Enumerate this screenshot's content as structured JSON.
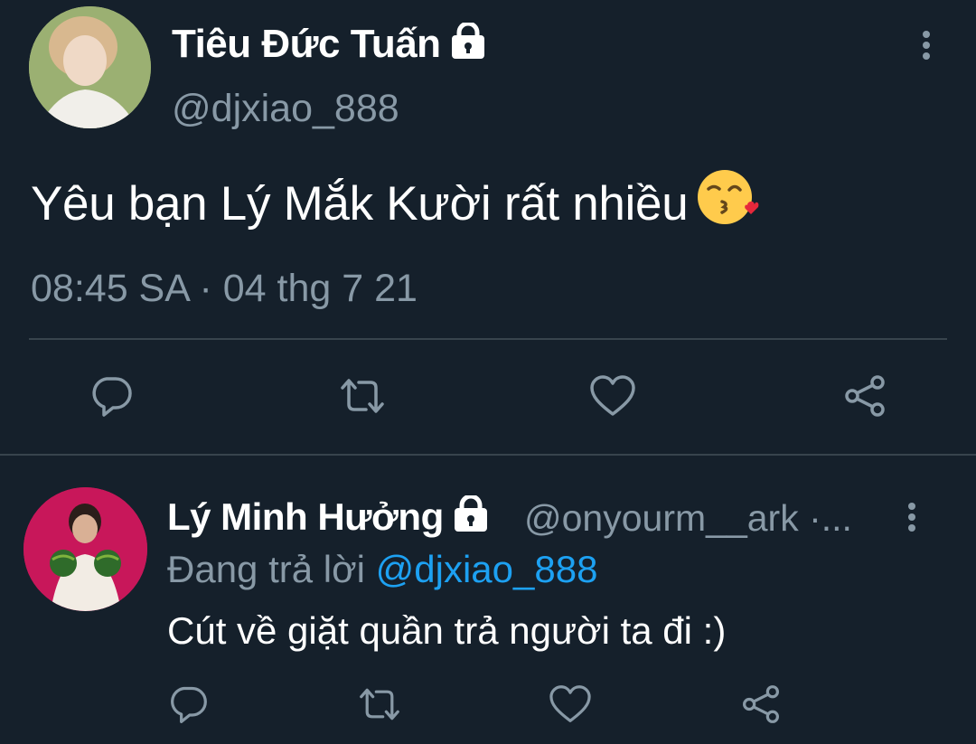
{
  "main_tweet": {
    "display_name": "Tiêu Đức Tuấn",
    "handle": "@djxiao_888",
    "text": "Yêu bạn Lý Mắk Kười rất nhiều",
    "emoji": "face-blowing-a-kiss",
    "timestamp": "08:45 SA · 04 thg 7 21",
    "actions": [
      "reply-icon",
      "retweet-icon",
      "like-icon",
      "share-icon"
    ]
  },
  "reply_tweet": {
    "display_name": "Lý Minh Hưởng",
    "handle": "@onyourm__ark ·...",
    "replying_prefix": "Đang trả lời",
    "replying_to": "@djxiao_888",
    "text": "Cút về giặt quần trả người ta đi :)",
    "actions": [
      "reply-icon",
      "retweet-icon",
      "like-icon",
      "share-icon"
    ]
  },
  "colors": {
    "background": "#15202b",
    "secondary_text": "#8899a6",
    "link": "#1da1f2",
    "divider": "#38444d"
  }
}
